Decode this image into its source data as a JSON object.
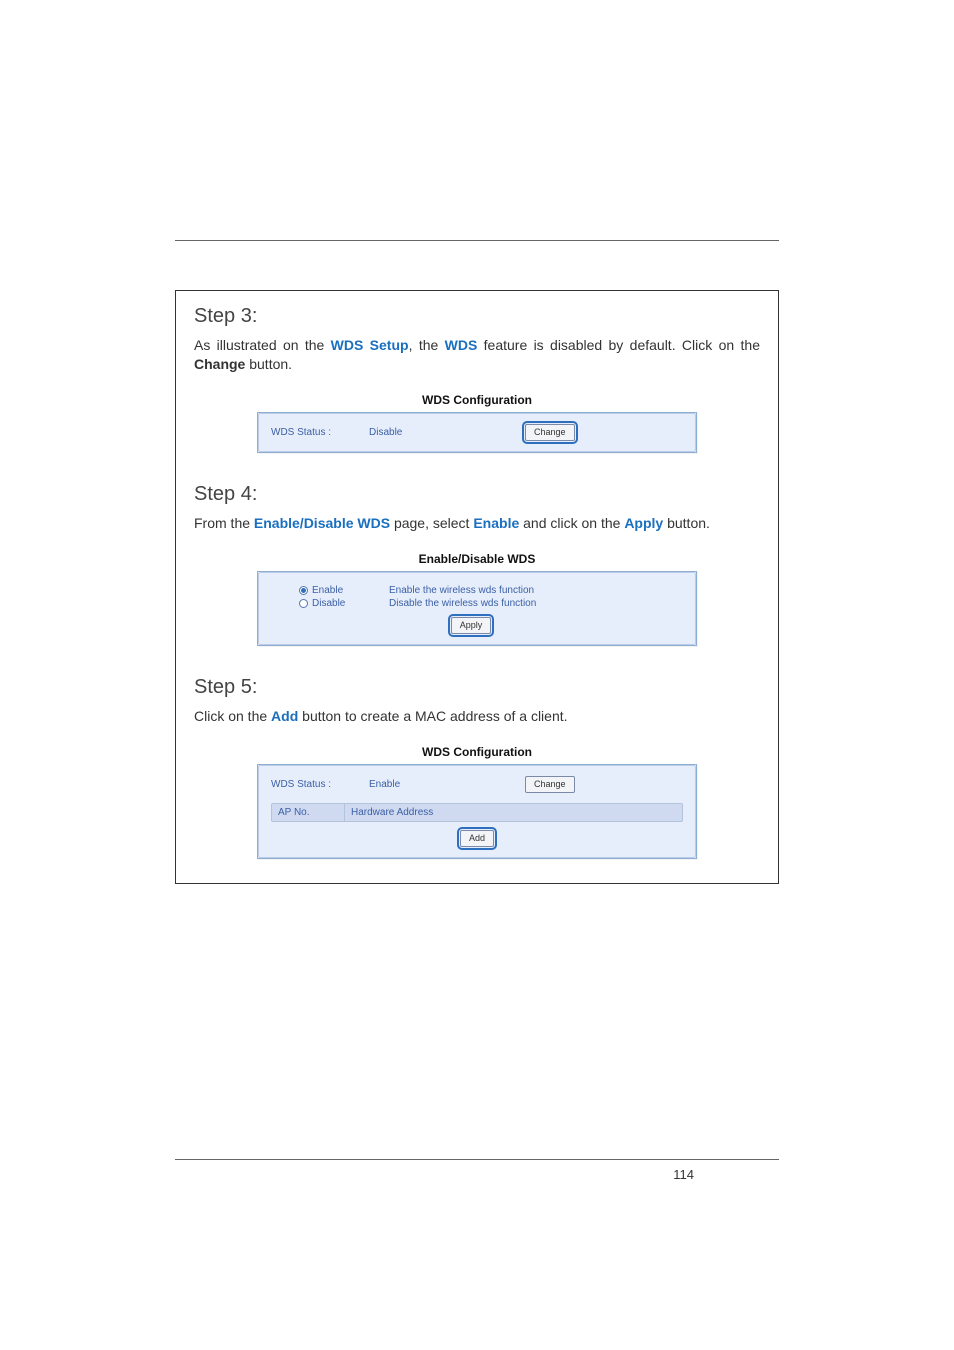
{
  "page_number": "114",
  "steps": {
    "s3": {
      "title": "Step 3:",
      "p1_a": "As illustrated on the ",
      "p1_b": "WDS Setup",
      "p1_c": ", the ",
      "p1_d": "WDS",
      "p1_e": " feature is disabled by default. Click on the ",
      "p1_f": "Change",
      "p1_g": " button."
    },
    "s4": {
      "title": "Step 4:",
      "p1_a": "From the ",
      "p1_b": "Enable/Disable WDS",
      "p1_c": " page, select ",
      "p1_d": "Enable",
      "p1_e": " and click on the ",
      "p1_f": "Apply",
      "p1_g": " button."
    },
    "s5": {
      "title": "Step 5:",
      "p1_a": "Click on the ",
      "p1_b": "Add",
      "p1_c": " button to create a MAC address of a client."
    }
  },
  "panels": {
    "wds1": {
      "title": "WDS Configuration",
      "status_label": "WDS Status :",
      "status_value": "Disable",
      "change_btn": "Change"
    },
    "enable_disable": {
      "title": "Enable/Disable WDS",
      "enable_label": "Enable",
      "enable_desc": "Enable the wireless wds function",
      "disable_label": "Disable",
      "disable_desc": "Disable the wireless wds function",
      "apply_btn": "Apply"
    },
    "wds2": {
      "title": "WDS Configuration",
      "status_label": "WDS Status :",
      "status_value": "Enable",
      "change_btn": "Change",
      "col1": "AP No.",
      "col2": "Hardware Address",
      "add_btn": "Add"
    }
  }
}
